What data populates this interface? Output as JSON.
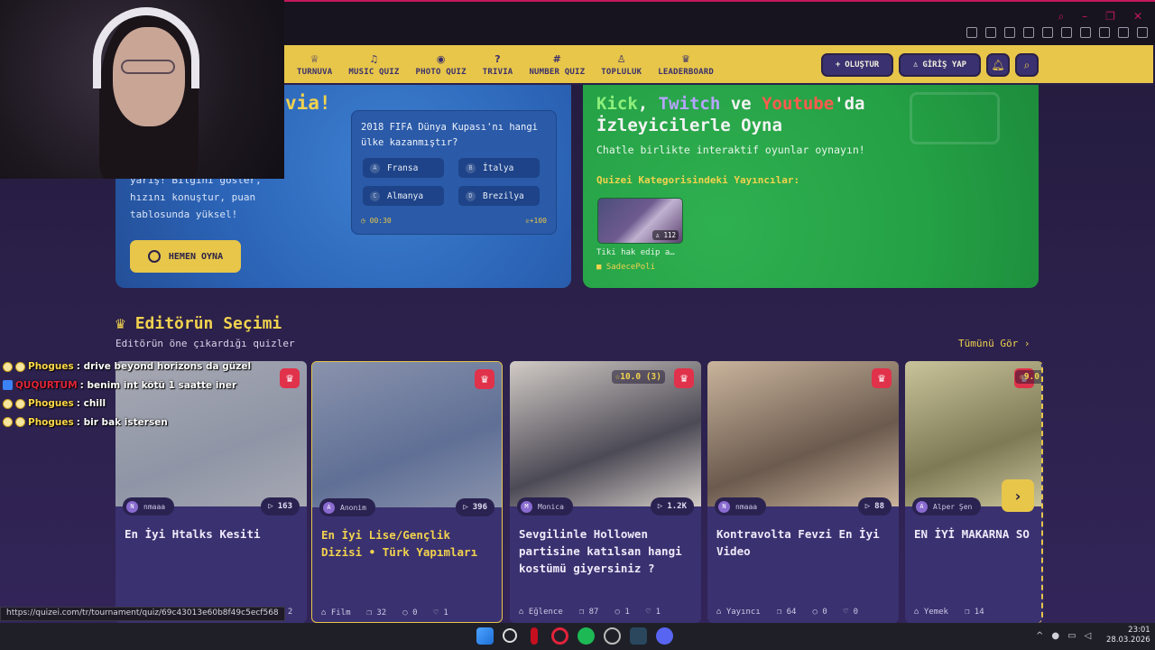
{
  "nav": {
    "items": [
      {
        "label": "TURNUVA",
        "icon": "trophy-icon",
        "glyph": "♕"
      },
      {
        "label": "MUSIC QUIZ",
        "icon": "music-icon",
        "glyph": "♫"
      },
      {
        "label": "PHOTO QUIZ",
        "icon": "camera-icon",
        "glyph": "◉"
      },
      {
        "label": "TRIVIA",
        "icon": "question-icon",
        "glyph": "?"
      },
      {
        "label": "NUMBER QUIZ",
        "icon": "hash-icon",
        "glyph": "#"
      },
      {
        "label": "TOPLULUK",
        "icon": "users-icon",
        "glyph": "♙"
      },
      {
        "label": "LEADERBOARD",
        "icon": "medal-icon",
        "glyph": "♛"
      }
    ],
    "create_label": "OLUŞTUR",
    "login_label": "GİRİŞ YAP"
  },
  "hero_left": {
    "title_fragment": "via!",
    "description": "yarış! Bilgini göster, hızını konuştur, puan tablosunda yüksel!",
    "play_label": "HEMEN OYNA",
    "question": "2018 FIFA Dünya Kupası'nı hangi ülke kazanmıştır?",
    "options": [
      {
        "key": "A",
        "text": "Fransa"
      },
      {
        "key": "B",
        "text": "İtalya"
      },
      {
        "key": "C",
        "text": "Almanya"
      },
      {
        "key": "D",
        "text": "Brezilya"
      }
    ],
    "timer": "00:30",
    "points": "+100"
  },
  "hero_right": {
    "kick": "Kick",
    "sep1": ", ",
    "twitch": "Twitch",
    "sep2": " ve ",
    "youtube": "Youtube",
    "suffix": "'da",
    "line2": "İzleyicilerle Oyna",
    "subtitle": "Chatle birlikte interaktif oyunlar oynayın!",
    "category_label": "Quizei Kategorisindeki Yayıncılar:",
    "video_title": "Tiki hak edip a…",
    "video_views": "112",
    "video_user": "SadecePoli"
  },
  "section": {
    "title": "Editörün Seçimi",
    "subtitle": "Editörün öne çıkardığı quizler",
    "see_all": "Tümünü Gör ›"
  },
  "cards": [
    {
      "title": "En İyi Htalks Kesiti",
      "author": "nmaaa",
      "avatar": "N",
      "plays": "163",
      "category": "",
      "questions": "",
      "comments": "",
      "likes": "2",
      "rating": "",
      "color1": "#8f95a6",
      "color2": "#a7a9b3"
    },
    {
      "title": "En İyi Lise/Gençlik Dizisi • Türk Yapımları",
      "author": "Anonim",
      "avatar": "A",
      "plays": "396",
      "category": "Film",
      "questions": "32",
      "comments": "0",
      "likes": "1",
      "rating": "",
      "color1": "#5f6f95",
      "color2": "#8a93ad"
    },
    {
      "title": "Sevgilinle Hollowen partisine katılsan hangi kostümü giyersiniz ?",
      "author": "Monica",
      "avatar": "M",
      "plays": "1.2K",
      "category": "Eğlence",
      "questions": "87",
      "comments": "1",
      "likes": "1",
      "rating": "10.0 (3)",
      "color1": "#4c4a55",
      "color2": "#d2cbc6"
    },
    {
      "title": "Kontravolta Fevzi En İyi Video",
      "author": "nmaaa",
      "avatar": "N",
      "plays": "88",
      "category": "Yayıncı",
      "questions": "64",
      "comments": "0",
      "likes": "0",
      "rating": "",
      "color1": "#6b5a4e",
      "color2": "#c9b49c"
    },
    {
      "title": "EN İYİ MAKARNA SO",
      "author": "Alper Şen",
      "avatar": "A",
      "plays": "",
      "category": "Yemek",
      "questions": "14",
      "comments": "",
      "likes": "",
      "rating": "9.0",
      "color1": "#7d7a55",
      "color2": "#c9c39a"
    }
  ],
  "chat": [
    {
      "user": "Phogues",
      "message": ": drive beyond horizons da güzel",
      "color": "yellow"
    },
    {
      "user": "QUQURTUM",
      "message": ": benim int kötü 1 saatte iner",
      "color": "red"
    },
    {
      "user": "Phogues",
      "message": ": chill",
      "color": "yellow"
    },
    {
      "user": "Phogues",
      "message": ": bir bak istersen",
      "color": "yellow"
    }
  ],
  "status_url": "https://quizei.com/tr/tournament/quiz/69c43013e60b8f49c5ecf568",
  "clock": {
    "time": "23:01",
    "date": "28.03.2026"
  }
}
